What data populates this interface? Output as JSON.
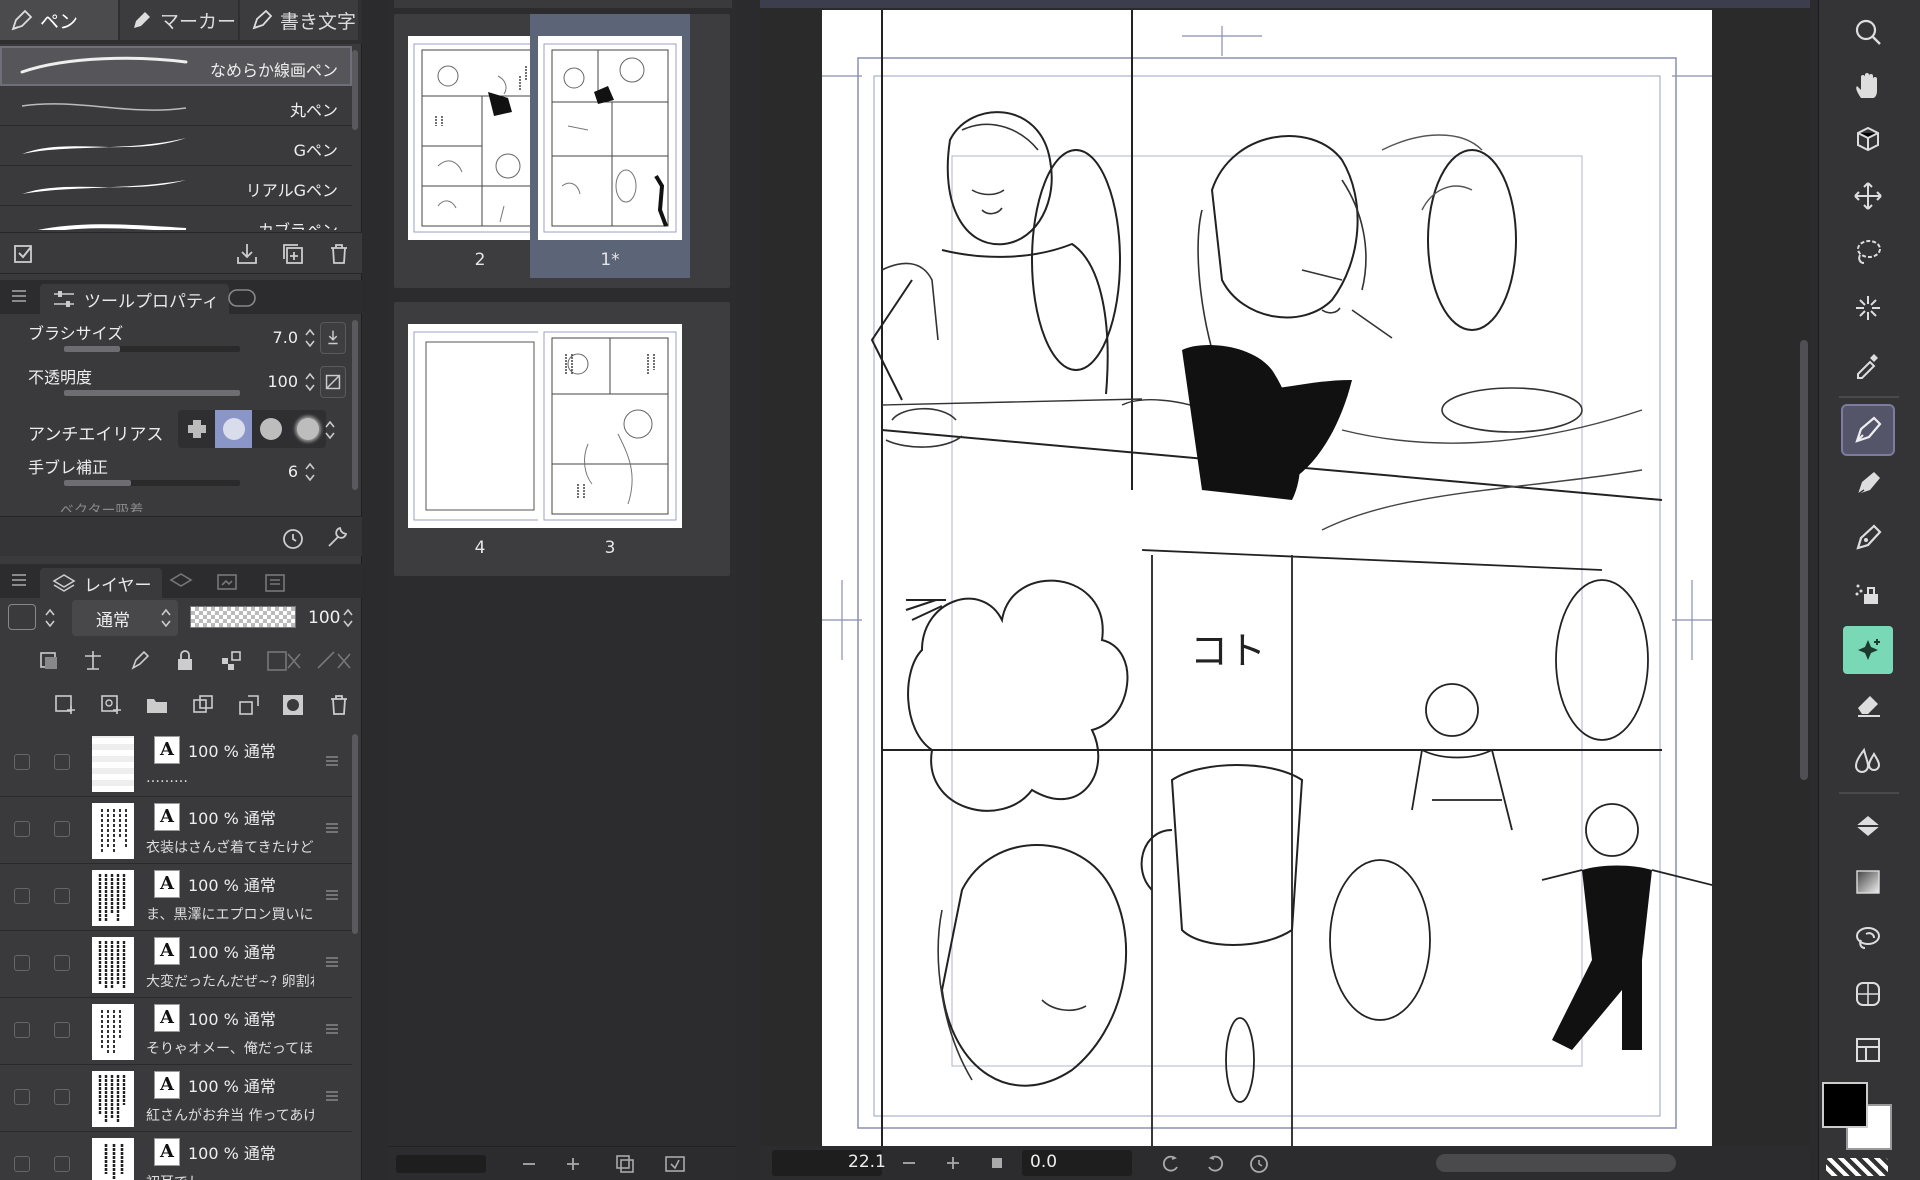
{
  "brush_tabs": [
    {
      "label": "ペン",
      "icon": "pen-icon"
    },
    {
      "label": "マーカー",
      "icon": "marker-icon"
    },
    {
      "label": "書き文字",
      "icon": "lettering-pen-icon"
    }
  ],
  "brushes": [
    {
      "label": "なめらか線画ペン"
    },
    {
      "label": "丸ペン"
    },
    {
      "label": "Gペン"
    },
    {
      "label": "リアルGペン"
    },
    {
      "label": "カブラペン"
    }
  ],
  "tool_property": {
    "tab_label": "ツールプロパティ",
    "brush_size_label": "ブラシサイズ",
    "brush_size_value": "7.0",
    "brush_size_fraction": 0.32,
    "opacity_label": "不透明度",
    "opacity_value": "100",
    "opacity_fraction": 1.0,
    "antialias_label": "アンチエイリアス",
    "antialias_selected_index": 1,
    "stabilization_label": "手ブレ補正",
    "stabilization_value": "6",
    "stabilization_fraction": 0.38,
    "cut_off_label": "ベクター吸着"
  },
  "layer_panel": {
    "tab_label": "レイヤー",
    "blend_mode": "通常",
    "opacity": "100",
    "layers": [
      {
        "opacity": "100 %",
        "mode": "通常",
        "name": "………"
      },
      {
        "opacity": "100 %",
        "mode": "通常",
        "name": "衣装はさんざ着てきたけど あ"
      },
      {
        "opacity": "100 %",
        "mode": "通常",
        "name": "ま、黒澤にエプロン買いに走"
      },
      {
        "opacity": "100 %",
        "mode": "通常",
        "name": "大変だったんだぜ~? 卵割れ"
      },
      {
        "opacity": "100 %",
        "mode": "通常",
        "name": "そりゃオメー、俺だってほじ"
      },
      {
        "opacity": "100 %",
        "mode": "通常",
        "name": "紅さんがお弁当 作ってあげた"
      },
      {
        "opacity": "100 %",
        "mode": "通常",
        "name": "初耳でし"
      }
    ]
  },
  "pages": {
    "spreads": [
      {
        "left_label": "2",
        "right_label": "1*",
        "selected": "right"
      },
      {
        "left_label": "4",
        "right_label": "3",
        "selected": "none"
      }
    ]
  },
  "canvas": {
    "sfx_text": "コト",
    "zoom": "22.1",
    "rotation": "0.0"
  },
  "colors": {
    "main": "#000000",
    "sub": "#ffffff",
    "accent": "#8b96c8",
    "active_tool": "#55556a",
    "panel": "#3a3a3c"
  },
  "tools": [
    "zoom-icon",
    "hand-icon",
    "3d-object-icon",
    "move-icon",
    "lasso-select-icon",
    "auto-select-icon",
    "eyedropper-icon",
    "pen-icon",
    "pencil-icon",
    "brush-icon",
    "airbrush-icon",
    "decoration-icon",
    "eraser-icon",
    "blend-icon",
    "fill-icon",
    "gradient-icon",
    "contour-fill-icon",
    "figure-icon",
    "frame-border-icon"
  ]
}
